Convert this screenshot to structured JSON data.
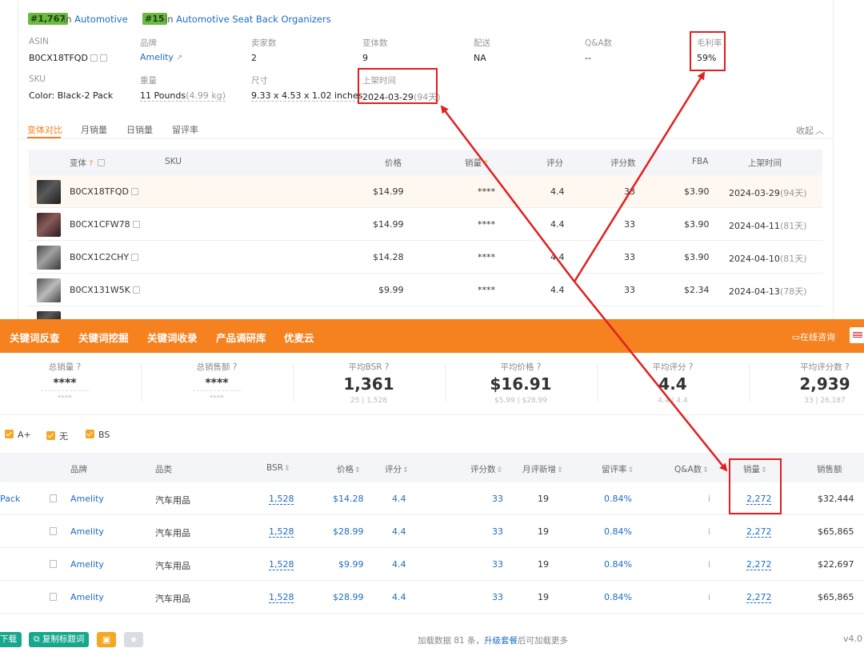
{
  "product": {
    "rank1": {
      "badge": "#1,767",
      "in": "in",
      "category": "Automotive"
    },
    "rank2": {
      "badge": "#15",
      "in": "in",
      "category": "Automotive Seat Back Organizers"
    },
    "fields": {
      "asin": {
        "label": "ASIN",
        "value": "B0CX18TFQD"
      },
      "brand": {
        "label": "品牌",
        "value": "Amelity"
      },
      "sellers": {
        "label": "卖家数",
        "value": "2"
      },
      "variants": {
        "label": "变体数",
        "value": "9"
      },
      "shipping": {
        "label": "配送",
        "value": "NA"
      },
      "qa": {
        "label": "Q&A数",
        "value": "--"
      },
      "margin": {
        "label": "毛利率",
        "value": "59%"
      },
      "sku": {
        "label": "SKU",
        "value": "Color: Black-2 Pack"
      },
      "weight": {
        "label": "重量",
        "value": "11 Pounds",
        "sub": "(4.99 kg)"
      },
      "size": {
        "label": "尺寸",
        "value": "9.33 x 4.53 x 1.02 inches"
      },
      "listed": {
        "label": "上架时间",
        "value": "2024-03-29",
        "sub": "(94天)"
      }
    }
  },
  "tabs": {
    "items": [
      "变体对比",
      "月销量",
      "日销量",
      "留评率"
    ],
    "collapse": "收起"
  },
  "variant_table": {
    "headers": [
      "变体",
      "SKU",
      "价格",
      "销量",
      "评分",
      "评分数",
      "FBA",
      "上架时间"
    ],
    "rows": [
      {
        "asin": "B0CX18TFQD",
        "price": "$14.99",
        "sales": "****",
        "rating": "4.4",
        "count": "33",
        "fba": "$3.90",
        "date": "2024-03-29",
        "days": "(94天)"
      },
      {
        "asin": "B0CX1CFW78",
        "price": "$14.99",
        "sales": "****",
        "rating": "4.4",
        "count": "33",
        "fba": "$3.90",
        "date": "2024-04-11",
        "days": "(81天)"
      },
      {
        "asin": "B0CX1C2CHY",
        "price": "$14.28",
        "sales": "****",
        "rating": "4.4",
        "count": "33",
        "fba": "$3.90",
        "date": "2024-04-10",
        "days": "(81天)"
      },
      {
        "asin": "B0CX131W5K",
        "price": "$9.99",
        "sales": "****",
        "rating": "4.4",
        "count": "33",
        "fba": "$2.34",
        "date": "2024-04-13",
        "days": "(78天)"
      }
    ]
  },
  "nav": {
    "items": [
      "关键词反查",
      "关键词挖掘",
      "关键词收录",
      "产品调研库",
      "优麦云"
    ],
    "consult": "在线咨询"
  },
  "stats": [
    {
      "label": "总销量",
      "value": "****",
      "sub": "****"
    },
    {
      "label": "总销售额",
      "value": "****",
      "sub": "****"
    },
    {
      "label": "平均BSR",
      "value": "1,361",
      "sub": "25 | 1,528"
    },
    {
      "label": "平均价格",
      "value": "$16.91",
      "sub": "$5.99 | $28.99"
    },
    {
      "label": "平均评分",
      "value": "4.4",
      "sub": "4.4 | 4.4"
    },
    {
      "label": "平均评分数",
      "value": "2,939",
      "sub": "33 | 26,187"
    }
  ],
  "filters": [
    "A+",
    "无",
    "BS"
  ],
  "product_table": {
    "headers": {
      "brand": "品牌",
      "category": "品类",
      "bsr": "BSR",
      "price": "价格",
      "rating": "评分",
      "reviews": "评分数",
      "monthly_new": "月评新增",
      "review_rate": "留评率",
      "qa": "Q&A数",
      "sales": "销量",
      "revenue": "销售额"
    },
    "rows": [
      {
        "lead": "Pack",
        "brand": "Amelity",
        "category": "汽车用品",
        "bsr": "1,528",
        "price": "$14.28",
        "rating": "4.4",
        "reviews": "33",
        "monthly_new": "19",
        "review_rate": "0.84%",
        "qa": "i",
        "sales": "2,272",
        "revenue": "$32,444"
      },
      {
        "lead": "",
        "brand": "Amelity",
        "category": "汽车用品",
        "bsr": "1,528",
        "price": "$28.99",
        "rating": "4.4",
        "reviews": "33",
        "monthly_new": "19",
        "review_rate": "0.84%",
        "qa": "i",
        "sales": "2,272",
        "revenue": "$65,865"
      },
      {
        "lead": "",
        "brand": "Amelity",
        "category": "汽车用品",
        "bsr": "1,528",
        "price": "$9.99",
        "rating": "4.4",
        "reviews": "33",
        "monthly_new": "19",
        "review_rate": "0.84%",
        "qa": "i",
        "sales": "2,272",
        "revenue": "$22,697"
      },
      {
        "lead": "",
        "brand": "Amelity",
        "category": "汽车用品",
        "bsr": "1,528",
        "price": "$28.99",
        "rating": "4.4",
        "reviews": "33",
        "monthly_new": "19",
        "review_rate": "0.84%",
        "qa": "i",
        "sales": "2,272",
        "revenue": "$65,865"
      }
    ]
  },
  "footer": {
    "download": "下载",
    "copy_title": "复制标题词",
    "msg_prefix": "加载数据 81 条，",
    "msg_link": "升级套餐",
    "msg_suffix": "后可加载更多",
    "version": "v4.0"
  },
  "colors": {
    "accent": "#f5811f",
    "link": "#1e6cc1",
    "annotation": "#e02020",
    "teal": "#17a78d"
  }
}
